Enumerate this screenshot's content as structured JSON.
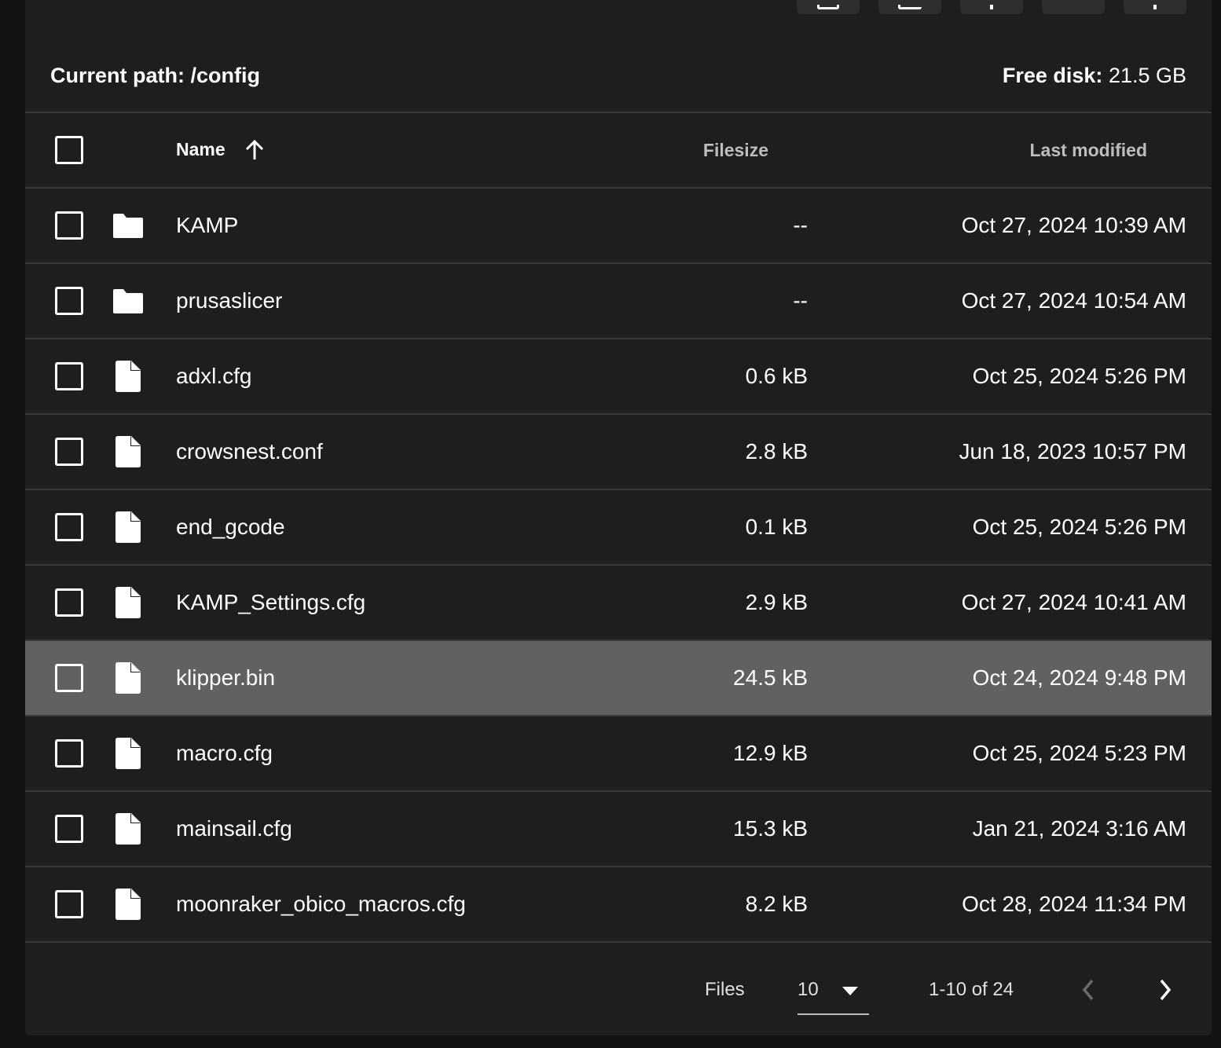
{
  "path_bar": {
    "current_path_label": "Current path:",
    "current_path": "/config",
    "free_disk_label": "Free disk:",
    "free_disk_value": "21.5 GB"
  },
  "table": {
    "columns": {
      "name": "Name",
      "filesize": "Filesize",
      "last_modified": "Last modified"
    },
    "rows": [
      {
        "type": "folder",
        "name": "KAMP",
        "size": "--",
        "modified": "Oct 27, 2024 10:39 AM"
      },
      {
        "type": "folder",
        "name": "prusaslicer",
        "size": "--",
        "modified": "Oct 27, 2024 10:54 AM"
      },
      {
        "type": "file",
        "name": "adxl.cfg",
        "size": "0.6 kB",
        "modified": "Oct 25, 2024 5:26 PM"
      },
      {
        "type": "file",
        "name": "crowsnest.conf",
        "size": "2.8 kB",
        "modified": "Jun 18, 2023 10:57 PM"
      },
      {
        "type": "file",
        "name": "end_gcode",
        "size": "0.1 kB",
        "modified": "Oct 25, 2024 5:26 PM"
      },
      {
        "type": "file",
        "name": "KAMP_Settings.cfg",
        "size": "2.9 kB",
        "modified": "Oct 27, 2024 10:41 AM"
      },
      {
        "type": "file",
        "name": "klipper.bin",
        "size": "24.5 kB",
        "modified": "Oct 24, 2024 9:48 PM"
      },
      {
        "type": "file",
        "name": "macro.cfg",
        "size": "12.9 kB",
        "modified": "Oct 25, 2024 5:23 PM"
      },
      {
        "type": "file",
        "name": "mainsail.cfg",
        "size": "15.3 kB",
        "modified": "Jan 21, 2024 3:16 AM"
      },
      {
        "type": "file",
        "name": "moonraker_obico_macros.cfg",
        "size": "8.2 kB",
        "modified": "Oct 28, 2024 11:34 PM"
      }
    ]
  },
  "footer": {
    "files_label": "Files",
    "per_page": "10",
    "range": "1-10 of 24"
  },
  "icons": {
    "folder": "folder-icon",
    "file": "file-icon",
    "sort": "arrow-up-icon",
    "prev": "chevron-left-icon",
    "next": "chevron-right-icon",
    "caret": "caret-down-icon"
  },
  "colors": {
    "panel_bg": "#1e1e1e",
    "page_bg": "#121212",
    "hover_row": "#616161",
    "divider": "#3a3a3a"
  }
}
